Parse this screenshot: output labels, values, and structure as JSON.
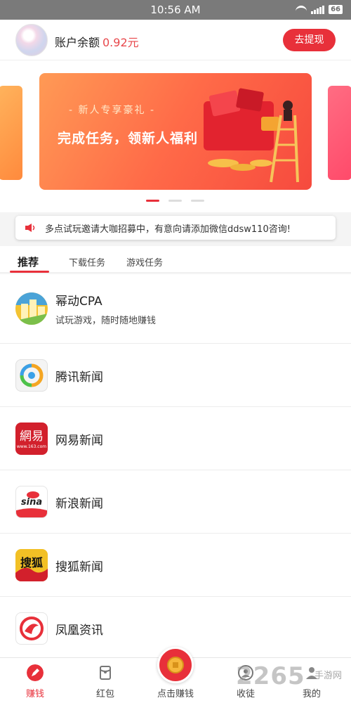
{
  "status_bar": {
    "time": "10:56 AM",
    "battery": "66"
  },
  "header": {
    "balance_label": "账户余额",
    "balance_value": "0.92元",
    "withdraw_label": "去提现"
  },
  "banner": {
    "subtitle": "- 新人专享豪礼 -",
    "title": "完成任务，领新人福利",
    "pages": 3,
    "active_page": 1
  },
  "notice": {
    "text": "多点试玩邀请大咖招募中，有意向请添加微信ddsw110咨询!"
  },
  "tabs": [
    {
      "label": "推荐",
      "active": true
    },
    {
      "label": "下载任务",
      "active": false
    },
    {
      "label": "游戏任务",
      "active": false
    }
  ],
  "items": [
    {
      "name": "幂动CPA",
      "desc": "试玩游戏，随时随地赚钱",
      "icon": "mdcpa-icon"
    },
    {
      "name": "腾讯新闻",
      "icon": "tencent-news-icon"
    },
    {
      "name": "网易新闻",
      "icon": "netease-news-icon",
      "icon_text": "網易",
      "icon_sub": "www.163.com"
    },
    {
      "name": "新浪新闻",
      "icon": "sina-news-icon",
      "icon_text": "sina"
    },
    {
      "name": "搜狐新闻",
      "icon": "sohu-news-icon",
      "icon_text": "搜狐"
    },
    {
      "name": "凤凰资讯",
      "icon": "ifeng-icon"
    }
  ],
  "bottom_nav": [
    {
      "label": "赚钱",
      "active": true,
      "icon": "pencil-icon"
    },
    {
      "label": "红包",
      "active": false,
      "icon": "red-envelope-icon"
    },
    {
      "label": "点击赚钱",
      "active": false,
      "icon": "coin-icon"
    },
    {
      "label": "收徒",
      "active": false,
      "icon": "apprentice-icon"
    },
    {
      "label": "我的",
      "active": false,
      "icon": "profile-icon"
    }
  ],
  "watermark": {
    "text": "2265",
    "sub": "手游网"
  },
  "colors": {
    "accent": "#e8303a",
    "balance": "#e8484c"
  }
}
